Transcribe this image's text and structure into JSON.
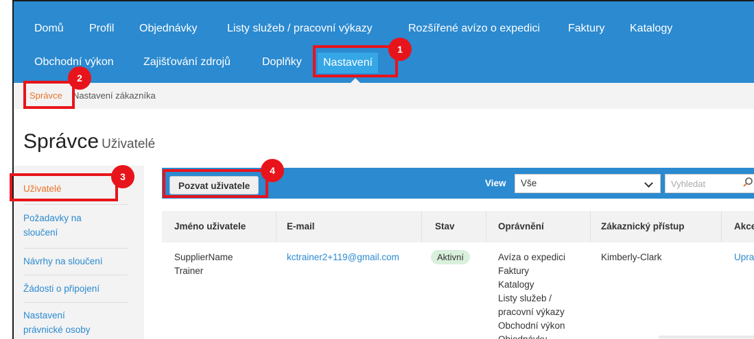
{
  "nav": {
    "row1": [
      {
        "id": "home",
        "label": "Domů"
      },
      {
        "id": "profile",
        "label": "Profil"
      },
      {
        "id": "orders",
        "label": "Objednávky"
      },
      {
        "id": "timesheets",
        "label": "Listy služeb / pracovní výkazy"
      },
      {
        "id": "asn",
        "label": "Rozšířené avízo o expedici"
      },
      {
        "id": "invoices",
        "label": "Faktury"
      },
      {
        "id": "catalogs",
        "label": "Katalogy"
      }
    ],
    "row2": [
      {
        "id": "performance",
        "label": "Obchodní výkon"
      },
      {
        "id": "sourcing",
        "label": "Zajišťování zdrojů"
      },
      {
        "id": "addons",
        "label": "Doplňky"
      },
      {
        "id": "settings",
        "label": "Nastavení",
        "active": true
      }
    ]
  },
  "subnav": [
    {
      "label": "Správce",
      "active": true
    },
    {
      "label": "Nastavení zákazníka"
    }
  ],
  "page": {
    "title": "Správce",
    "subtitle": "Uživatelé"
  },
  "leftmenu": [
    {
      "label": "Uživatelé",
      "active": true
    },
    {
      "label": "Požadavky na sloučení"
    },
    {
      "label": "Návrhy na sloučení"
    },
    {
      "label": "Žádosti o připojení"
    },
    {
      "label": "Nastavení právnické osoby"
    }
  ],
  "toolbar": {
    "invite_label": "Pozvat uživatele",
    "view_label": "View",
    "view_value": "Vše",
    "search_placeholder": "Vyhledat",
    "search_icon": "search-icon",
    "select_icon": "chevron-down-icon"
  },
  "table": {
    "headers": [
      "Jméno uživatele",
      "E-mail",
      "Stav",
      "Oprávnění",
      "Zákaznický přístup",
      "Akce"
    ],
    "rows": [
      {
        "name_line1": "SupplierName",
        "name_line2": "Trainer",
        "email": "kctrainer2+119@gmail.com",
        "status": "Aktivní",
        "permissions": [
          "Avíza o expedici",
          "Faktury",
          "Katalogy",
          "Listy služeb /",
          "pracovní výkazy",
          "Obchodní výkon",
          "Objednávky"
        ],
        "customer_access": "Kimberly-Clark",
        "action": "Upravit"
      }
    ]
  },
  "callouts": [
    "1",
    "2",
    "3",
    "4"
  ],
  "colors": {
    "nav_blue": "#2b8ad0",
    "nav_active": "#36a7e6",
    "accent_orange": "#e8742a",
    "callout_red": "#e8141b",
    "status_green_bg": "#d9f0dd"
  }
}
